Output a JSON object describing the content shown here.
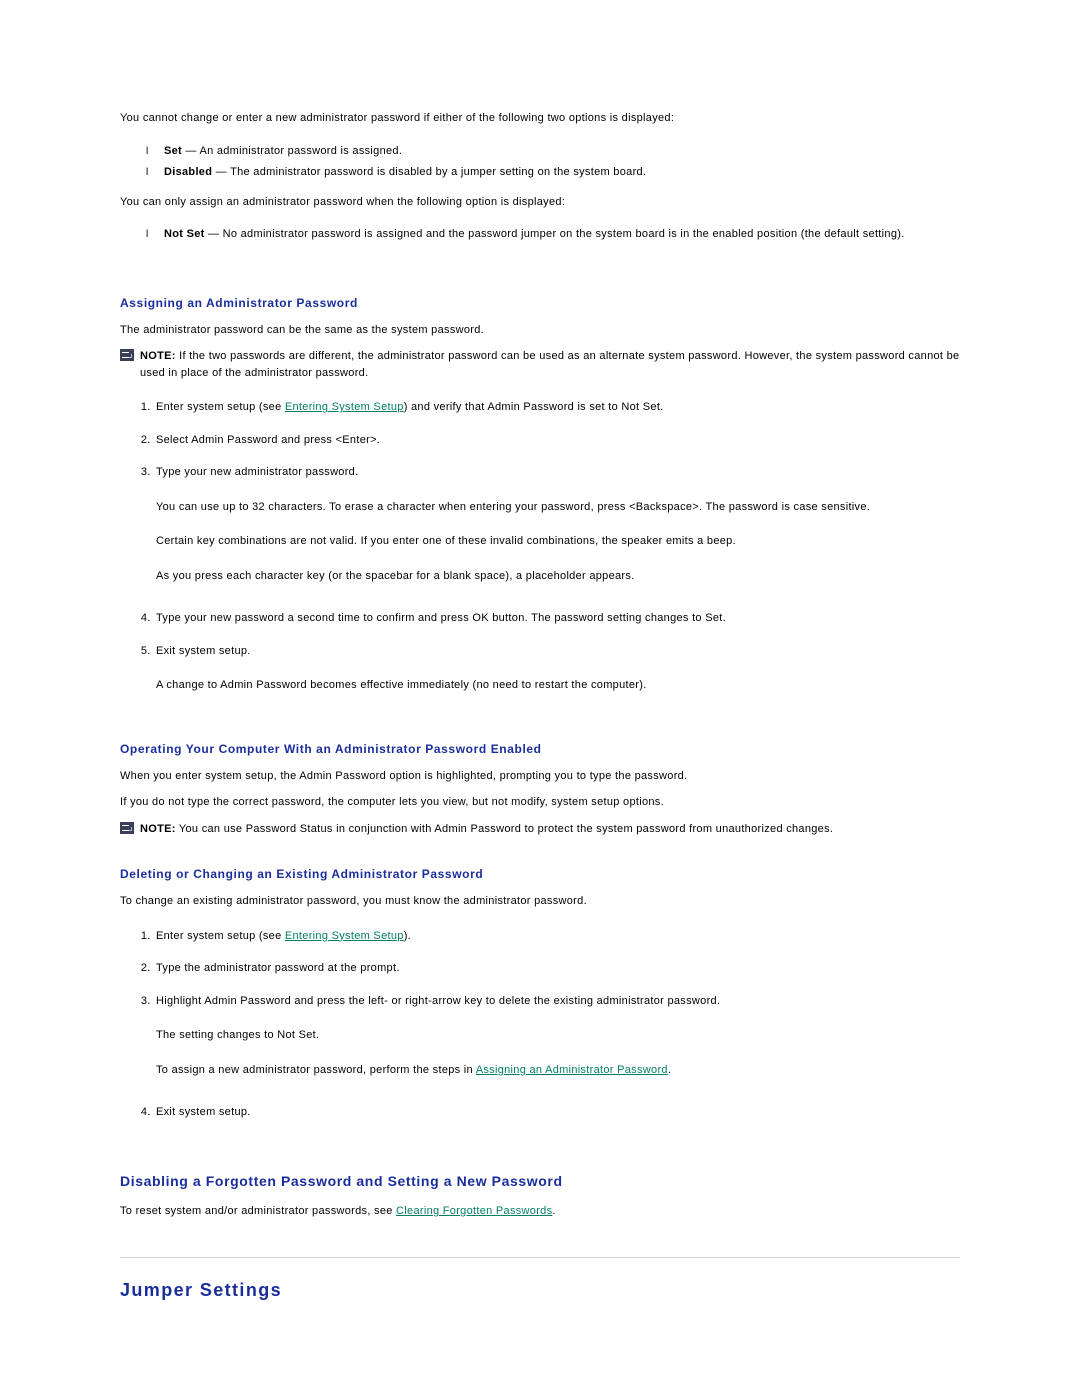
{
  "intro": {
    "cannot_change": "You cannot change or enter a new administrator password if either of the following two options is displayed:",
    "bullets": [
      {
        "term": "Set",
        "dash": " — ",
        "desc": "An administrator password is assigned."
      },
      {
        "term": "Disabled",
        "dash": " — ",
        "desc": "The administrator password is disabled by a jumper setting on the system board."
      }
    ],
    "only_assign": "You can only assign an administrator password when the following option is displayed:",
    "bullets2": [
      {
        "term": "Not Set",
        "dash": " — ",
        "desc": "No administrator password is assigned and the password jumper on the system board is in the enabled position (the default setting)."
      }
    ]
  },
  "assign": {
    "heading": "Assigning an Administrator Password",
    "intro": "The administrator password can be the same as the system password.",
    "note_label": "NOTE:",
    "note_text": " If the two passwords are different, the administrator password can be used as an alternate system password. However, the system password cannot be used in place of the administrator password.",
    "step1_pre": "Enter system setup (see ",
    "step1_link": "Entering System Setup",
    "step1_post": ") and verify that Admin Password is set to Not Set.",
    "step2": "Select Admin Password and press <Enter>.",
    "step3_main": "Type your new administrator password.",
    "step3_a": "You can use up to 32 characters. To erase a character when entering your password, press <Backspace>. The password is case sensitive.",
    "step3_b": "Certain key combinations are not valid. If you enter one of these invalid combinations, the speaker emits a beep.",
    "step3_c": "As you press each character key (or the spacebar for a blank space), a placeholder appears.",
    "step4": "Type your new password a second time to confirm and press OK button. The password setting changes to Set.",
    "step5_main": "Exit system setup.",
    "step5_a": "A change to Admin Password becomes effective immediately (no need to restart the computer)."
  },
  "operating": {
    "heading": "Operating Your Computer With an Administrator Password Enabled",
    "p1": "When you enter system setup, the Admin Password option is highlighted, prompting you to type the password.",
    "p2": "If you do not type the correct password, the computer lets you view, but not modify, system setup options.",
    "note_label": "NOTE:",
    "note_text": " You can use Password Status in conjunction with Admin Password to protect the system password from unauthorized changes."
  },
  "deleting": {
    "heading": "Deleting or Changing an Existing Administrator Password",
    "intro": "To change an existing administrator password, you must know the administrator password.",
    "step1_pre": "Enter system setup (see ",
    "step1_link": "Entering System Setup",
    "step1_post": ").",
    "step2": "Type the administrator password at the prompt.",
    "step3_main": "Highlight Admin Password and press the left- or right-arrow key to delete the existing administrator password.",
    "step3_a": "The setting changes to Not Set.",
    "step3_b_pre": "To assign a new administrator password, perform the steps in ",
    "step3_b_link": "Assigning an Administrator Password",
    "step3_b_post": ".",
    "step4": "Exit system setup."
  },
  "disable": {
    "heading": "Disabling a Forgotten Password and Setting a New Password",
    "p_pre": "To reset system and/or administrator passwords, see ",
    "p_link": "Clearing Forgotten Passwords",
    "p_post": "."
  },
  "jumper": {
    "heading": "Jumper Settings"
  }
}
